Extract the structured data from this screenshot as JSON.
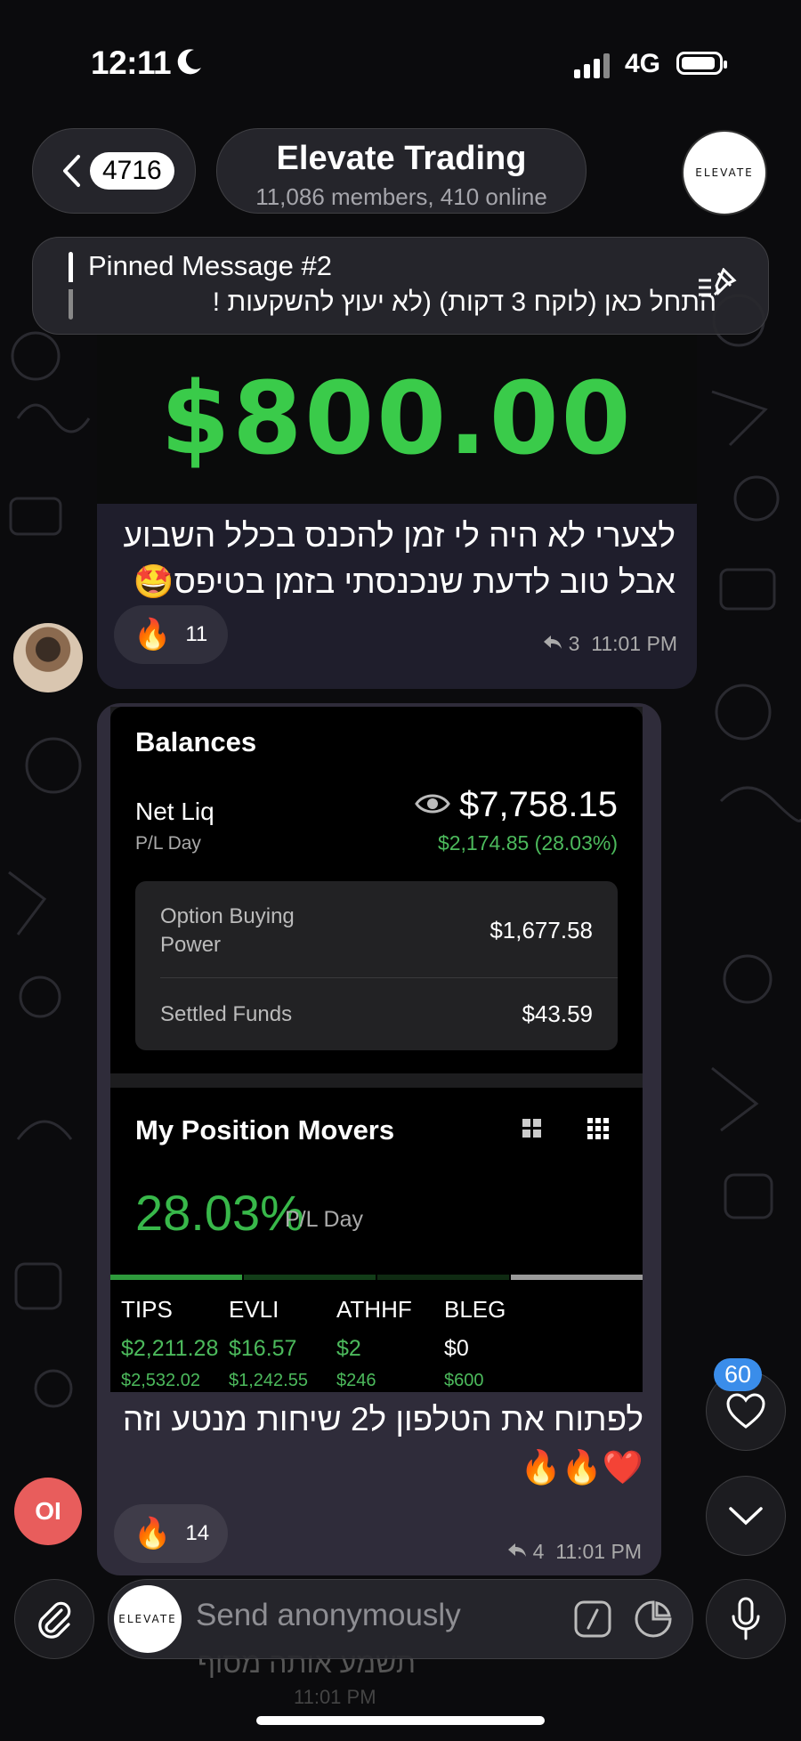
{
  "status_bar": {
    "time": "12:11",
    "network": "4G"
  },
  "header": {
    "back_count": "4716",
    "title": "Elevate Trading",
    "subtitle": "11,086 members, 410 online",
    "avatar_text": "ELEVATE"
  },
  "pinned": {
    "title": "Pinned Message #2",
    "text": "התחל כאן (לוקח 3 דקות) (לא יעוץ להשקעות !"
  },
  "message1": {
    "image_amount": "$800.00",
    "text_line1": "לצערי לא היה לי זמן להכנס בכלל השבוע",
    "text_line2": "אבל טוב לדעת שנכנסתי בזמן בטיפס🤩",
    "reaction_emoji": "🔥",
    "reaction_count": "11",
    "replies": "3",
    "time": "11:01 PM"
  },
  "message2": {
    "balances": {
      "title": "Balances",
      "net_liq_label": "Net Liq",
      "pl_day_label": "P/L Day",
      "net_liq_value": "$7,758.15",
      "pl_change": "$2,174.85 (28.03%)",
      "option_bp_label": "Option Buying Power",
      "option_bp_value": "$1,677.58",
      "settled_label": "Settled Funds",
      "settled_value": "$43.59"
    },
    "movers": {
      "title": "My Position Movers",
      "pct": "28.03%",
      "pct_label": "P/L Day",
      "tickers": [
        {
          "symbol": "TIPS",
          "v1": "$2,211.28",
          "v2": "$2,532.02",
          "color": "#4cba5c"
        },
        {
          "symbol": "EVLI",
          "v1": "$16.57",
          "v2": "$1,242.55",
          "color": "#4cba5c"
        },
        {
          "symbol": "ATHHF",
          "v1": "$2",
          "v2": "$246",
          "color": "#4cba5c"
        },
        {
          "symbol": "BLEG",
          "v1": "$0",
          "v2": "$600",
          "color": "#ffffff"
        }
      ]
    },
    "text_line1": "לפתוח את הטלפון ל2 שיחות מנטע וזה",
    "text_line2": "❤️🔥🔥",
    "reaction_emoji": "🔥",
    "reaction_count": "14",
    "replies": "4",
    "time": "11:01 PM"
  },
  "sender2_initials": "OI",
  "heart_badge": "60",
  "input": {
    "placeholder": "Send anonymously",
    "avatar_text": "ELEVATE"
  },
  "behind_input": {
    "text": "תשמע אותה מסוף",
    "time": "11:01 PM"
  },
  "colors": {
    "accent_green": "#3acb4a",
    "badge_blue": "#3a8dea",
    "oi_red": "#e85d5c"
  }
}
